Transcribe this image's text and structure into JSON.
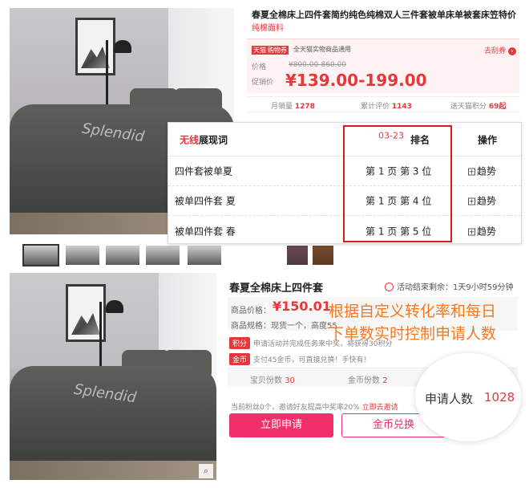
{
  "top": {
    "title": "春夏全棉床上四件套简约纯色纯棉双人三件套被单床单被套床笠特价",
    "brand": "纯棉面料",
    "shipping": {
      "tmall_tag": "天猫",
      "coupon_tag": "购物券",
      "text": "全天猫实物商品通用",
      "link": "去刮券"
    },
    "price": {
      "label": "价格",
      "original": "¥800.00-860.00",
      "promo_label": "促销价",
      "promo": "¥139.00-199.00"
    },
    "stats": [
      {
        "label": "月销量",
        "value": "1278"
      },
      {
        "label": "累计评价",
        "value": "1143"
      },
      {
        "label": "送天猫积分",
        "value": "69起"
      }
    ],
    "rank_panel": {
      "header_prefix": "无线",
      "header_suffix": "展现词",
      "date": "03-23",
      "rank_col": "排名",
      "action_col": "操作",
      "rows": [
        {
          "keyword": "四件套被单夏",
          "rank": "第 1 页 第 3 位",
          "action": "趋势"
        },
        {
          "keyword": "被单四件套 夏",
          "rank": "第 1 页 第 4 位",
          "action": "趋势"
        },
        {
          "keyword": "被单四件套 春",
          "rank": "第 1 页 第 5 位",
          "action": "趋势"
        }
      ]
    },
    "photo_text": "Splendid",
    "thumb_count": 7
  },
  "bottom": {
    "title": "春夏全棉床上四件套",
    "timer_label": "活动结束剩余：",
    "timer_value": "1天9小时59分钟",
    "price_label": "商品价格：",
    "price": "¥150.01",
    "spec_label": "商品规格：",
    "spec_value": "现货一个，高度55",
    "info1_tag": "积分",
    "info1_text": "申请活动并完成任务来中奖，将获得30积分",
    "info2_tag": "金币",
    "info2_text": "支付45金币，可直接兑换！手快有！",
    "count1_label": "宝贝份数",
    "count1_value": "30",
    "count2_label": "金币份数",
    "count2_value": "2",
    "fans_text": "当前粉丝0个，邀请好友提高中奖率20%",
    "fans_link": "立即去邀请",
    "apply_button": "立即申请",
    "coin_button": "金币兑换",
    "overlay_line1": "根据自定义转化率和每日",
    "overlay_line2": "下单数实时控制申请人数",
    "applicants_label": "申请人数",
    "applicants_value": "1028"
  },
  "colors": {
    "accent": "#e4393c",
    "button": "#f0306b",
    "overlay_text": "#f47920",
    "highlight_box": "#e0161d"
  }
}
